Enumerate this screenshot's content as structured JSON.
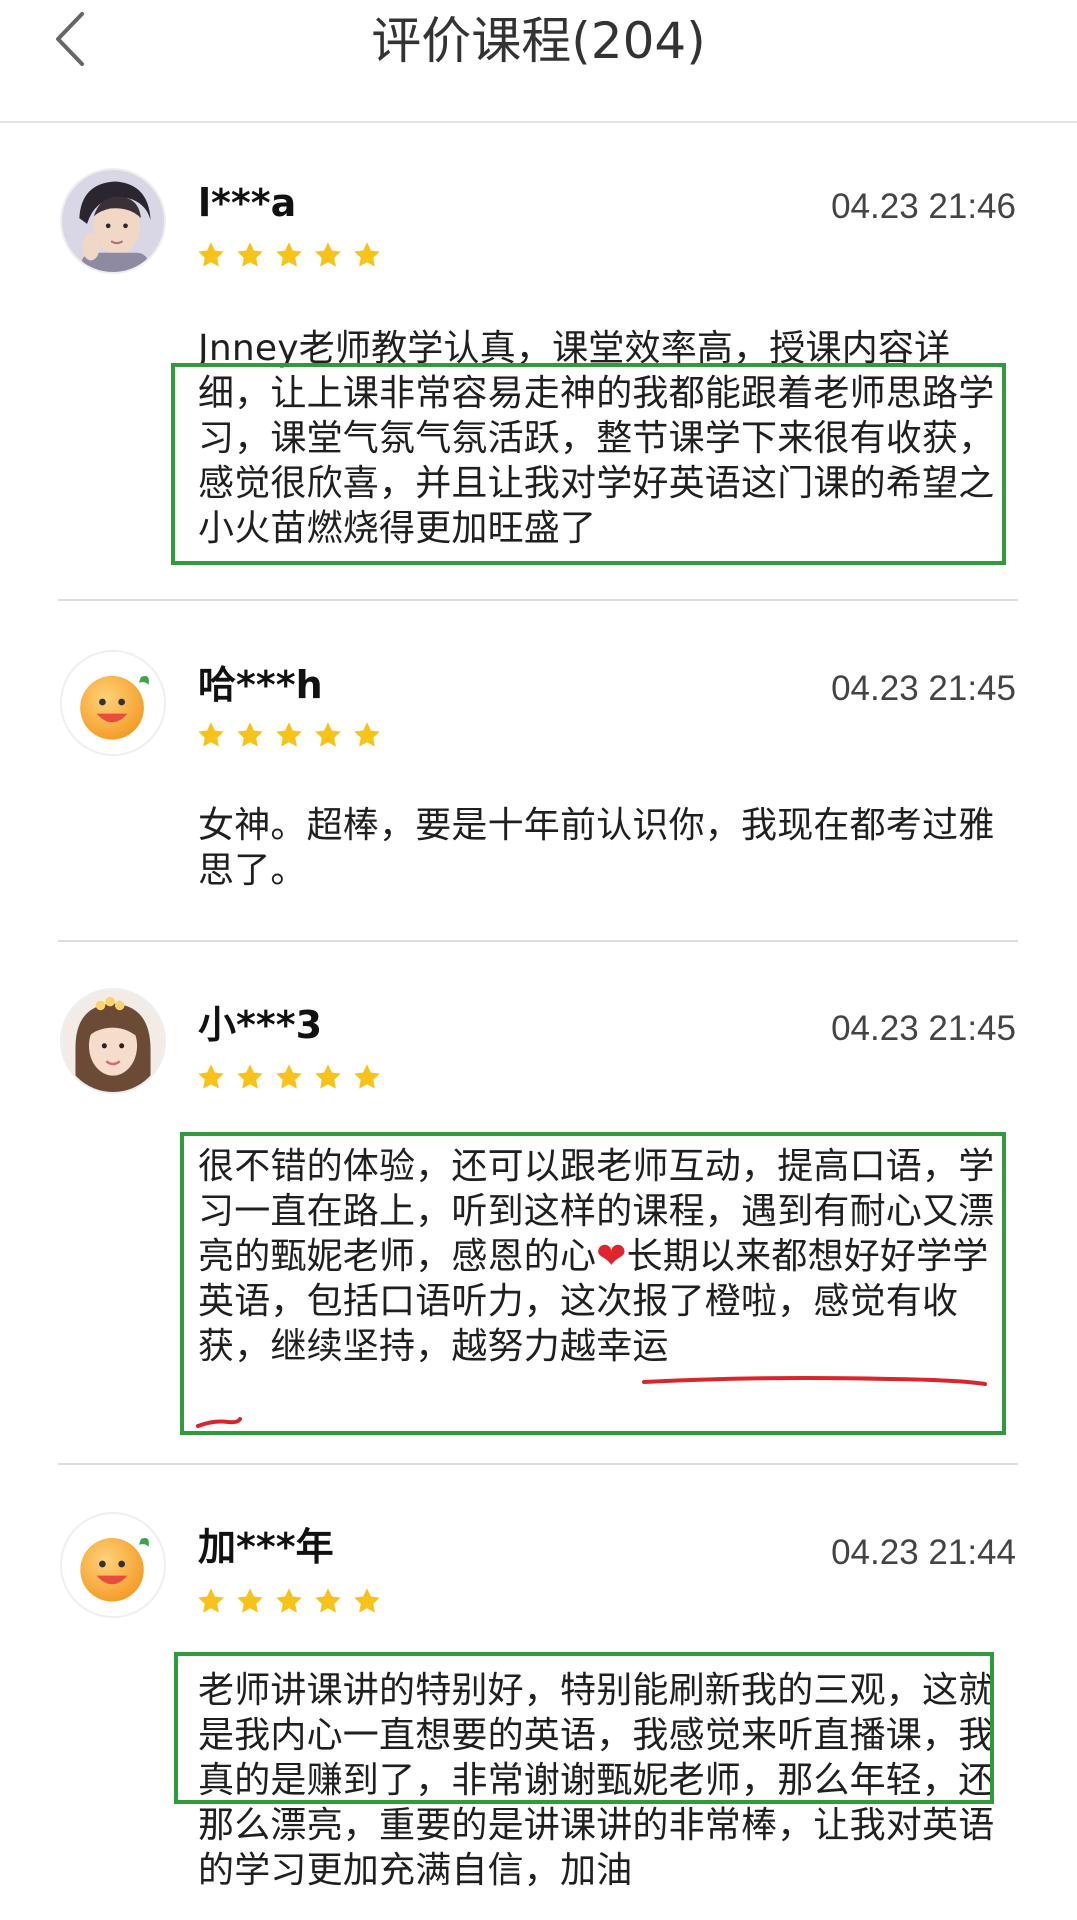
{
  "header": {
    "title": "评价课程(204)",
    "back_icon": "chevron-left-icon"
  },
  "colors": {
    "star": "#f7c21a",
    "highlight_box": "#2f9c3b",
    "underline": "#d8262c",
    "heart": "#e0242d"
  },
  "reviews": [
    {
      "username": "l***a",
      "time": "04.23 21:46",
      "rating": 5,
      "avatar": "user-photo-avatar",
      "content": "Jnney老师教学认真，课堂效率高，授课内容详细，让上课非常容易走神的我都能跟着老师思路学习，课堂气氛气氛活跃，整节课学下来很有收获，感觉很欣喜，并且让我对学好英语这门课的希望之小火苗燃烧得更加旺盛了"
    },
    {
      "username": "哈***h",
      "time": "04.23 21:45",
      "rating": 5,
      "avatar": "default-smiley-avatar",
      "content": "女神。超棒，要是十年前认识你，我现在都考过雅思了。"
    },
    {
      "username": "小***3",
      "time": "04.23 21:45",
      "rating": 5,
      "avatar": "user-photo-avatar",
      "content_before_heart": "很不错的体验，还可以跟老师互动，提高口语，学习一直在路上，听到这样的课程，遇到有耐心又漂亮的甄妮老师，感恩的心",
      "heart": "❤",
      "content_after_heart": "长期以来都想好好学学英语，包括口语听力，这次报了橙啦，感觉有收获，继续坚持，越努力越幸运"
    },
    {
      "username": "加***年",
      "time": "04.23 21:44",
      "rating": 5,
      "avatar": "default-smiley-avatar",
      "content": "老师讲课讲的特别好，特别能刷新我的三观，这就是我内心一直想要的英语，我感觉来听直播课，我真的是赚到了，非常谢谢甄妮老师，那么年轻，还那么漂亮，重要的是讲课讲的非常棒，让我对英语的学习更加充满自信，加油"
    }
  ]
}
